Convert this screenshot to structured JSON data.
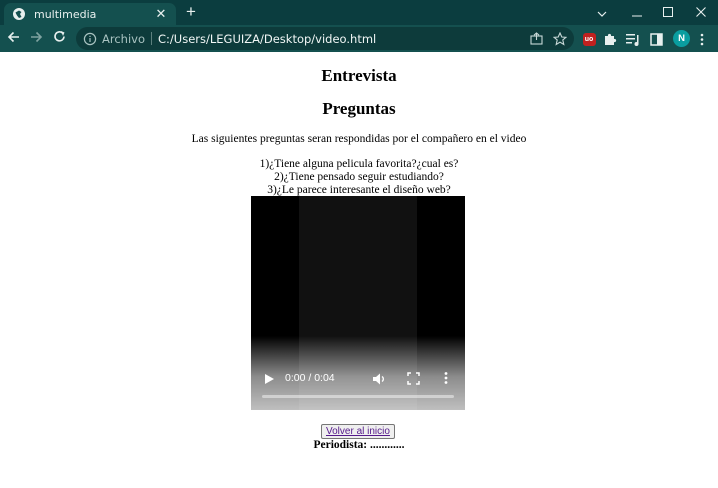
{
  "browser": {
    "tab": {
      "title": "multimedia",
      "close_glyph": "✕",
      "favicon": "globe-icon"
    },
    "new_tab_glyph": "+",
    "window_controls": {
      "menu": "chevron-down-icon",
      "minimize": "minimize-icon",
      "maximize": "maximize-icon",
      "close": "close-icon"
    },
    "address_bar": {
      "security_label": "Archivo",
      "url": "C:/Users/LEGUIZA/Desktop/video.html"
    },
    "profile_initial": "N",
    "colors": {
      "titlebar": "#0b3d3f",
      "toolbar": "#14504f",
      "omnibox": "#0d3b3b",
      "avatar": "#0a9ea0"
    }
  },
  "page": {
    "heading1": "Entrevista",
    "heading2": "Preguntas",
    "intro": "Las siguientes preguntas seran respondidas por el compañero en el video",
    "questions": [
      "1)¿Tiene alguna pelicula favorita?¿cual es?",
      "2)¿Tiene pensado seguir estudiando?",
      "3)¿Le parece interesante el diseño web?"
    ],
    "video": {
      "time_display": "0:00 / 0:04",
      "progress": 0
    },
    "back_button": "Volver al inicio",
    "periodista": "Periodista: ............"
  }
}
